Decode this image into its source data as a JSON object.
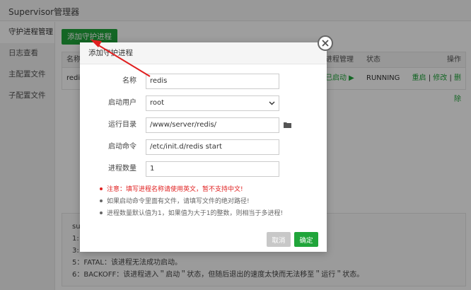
{
  "app": {
    "title": "Supervisor管理器"
  },
  "sidebar": {
    "items": [
      {
        "label": "守护进程管理"
      },
      {
        "label": "日志查看"
      },
      {
        "label": "主配置文件"
      },
      {
        "label": "子配置文件"
      }
    ]
  },
  "toolbar": {
    "add_label": "添加守护进程"
  },
  "table": {
    "headers": {
      "name": "名称",
      "manage": "进程管理",
      "state": "状态",
      "ops": "操作"
    },
    "rows": [
      {
        "name": "redis",
        "manage": "已启动 ▶",
        "state": "RUNNING",
        "op_restart": "重启",
        "op_edit": "修改",
        "op_delete": "删除",
        "sep": "|"
      }
    ]
  },
  "info": {
    "lines": [
      "sup",
      "1:",
      "3:",
      "5：FATAL：该进程无法成功启动。",
      "6：BACKOFF：该进程进入＂启动＂状态，但随后退出的速度太快而无法移至＂运行＂状态。"
    ]
  },
  "dialog": {
    "title": "添加守护进程",
    "fields": {
      "name": {
        "label": "名称",
        "value": "redis"
      },
      "user": {
        "label": "启动用户",
        "value": "root"
      },
      "dir": {
        "label": "运行目录",
        "value": "/www/server/redis/"
      },
      "cmd": {
        "label": "启动命令",
        "value": "/etc/init.d/redis start"
      },
      "count": {
        "label": "进程数量",
        "value": "1"
      }
    },
    "notes": [
      "注意：填写进程名称请使用英文，暂不支持中文!",
      "如果启动命令里面有文件，请填写文件的绝对路径!",
      "进程数量默认值为1，如果值为大于1的整数，则相当于多进程!"
    ],
    "cancel_label": "取消",
    "ok_label": "确定"
  },
  "colors": {
    "accent": "#20a53a",
    "warning": "#e02020",
    "annotation": "#e02020"
  }
}
